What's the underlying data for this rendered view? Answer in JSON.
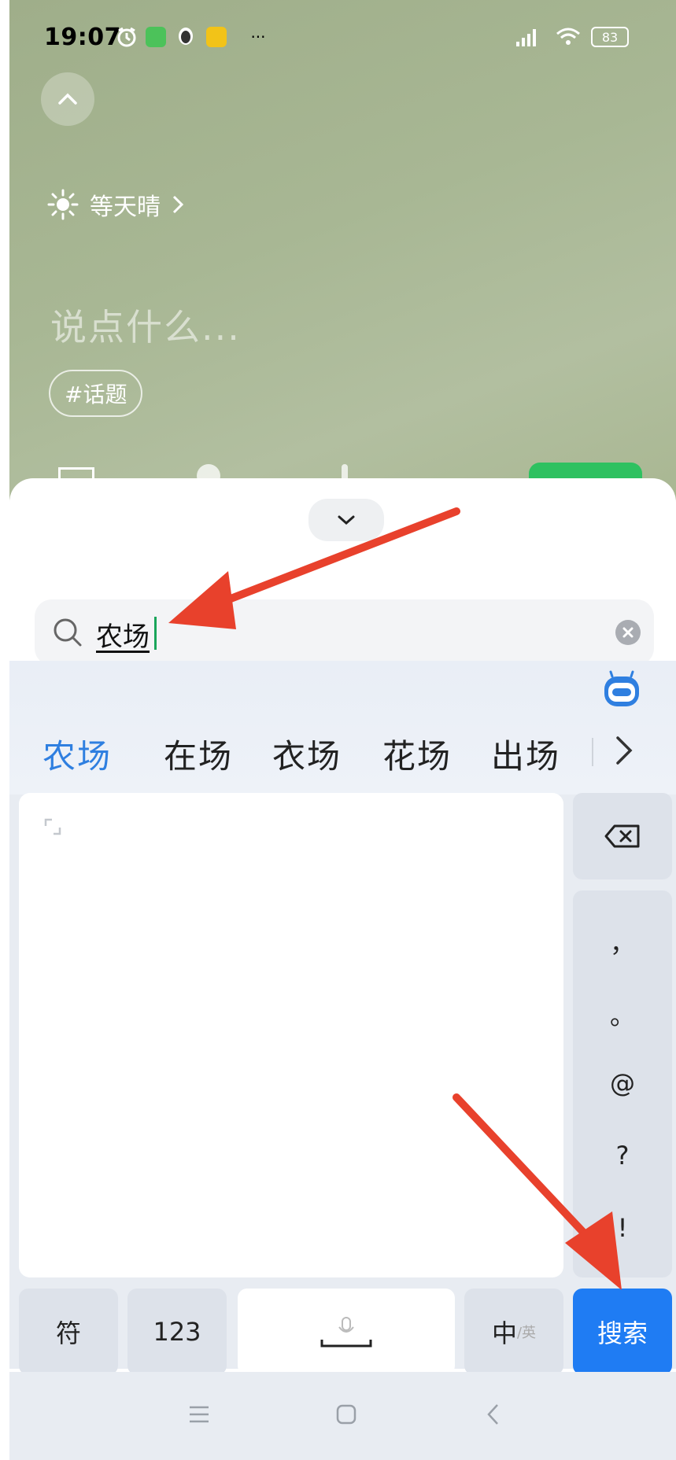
{
  "status_bar": {
    "time": "19:07",
    "battery": "83",
    "more": "···"
  },
  "compose": {
    "weather": "等天晴",
    "placeholder": "说点什么...",
    "topic": "#话题"
  },
  "search": {
    "value": "农场"
  },
  "candidates": [
    "农场",
    "在场",
    "衣场",
    "花场",
    "出场"
  ],
  "punctuation": [
    "，",
    "。",
    "@",
    "?",
    "!"
  ],
  "keys": {
    "symbols": "符",
    "numbers": "123",
    "lang_main": "中",
    "lang_alt": "/英",
    "search": "搜索"
  },
  "colors": {
    "accent_blue": "#1f7cf3",
    "candidate_highlight": "#2f7fe0",
    "annotation_arrow": "#e8412c",
    "publish_green": "#2ec160"
  }
}
